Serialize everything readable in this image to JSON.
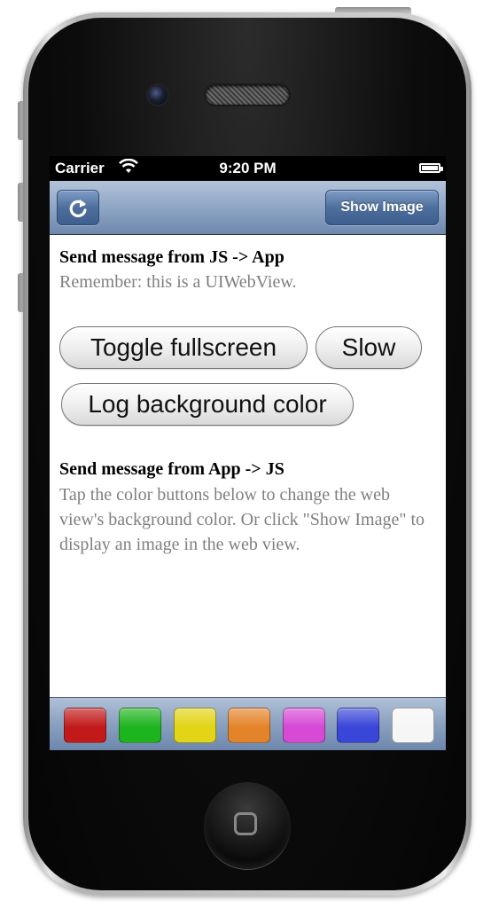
{
  "status_bar": {
    "carrier": "Carrier",
    "time": "9:20 PM"
  },
  "nav_bar": {
    "show_image_label": "Show Image",
    "refresh_icon": "refresh-icon"
  },
  "section_js_to_app": {
    "heading": "Send message from JS -> App",
    "subtitle": "Remember: this is a UIWebView.",
    "buttons": [
      "Toggle fullscreen",
      "Slow",
      "Log background color"
    ]
  },
  "section_app_to_js": {
    "heading": "Send message from App -> JS",
    "text": "Tap the color buttons below to change the web view's background color. Or click \"Show Image\" to display an image in the web view."
  },
  "toolbar": {
    "colors": [
      "#c21a1a",
      "#1eb41e",
      "#e2d416",
      "#e3842a",
      "#d64ad6",
      "#3a46d8",
      "#f6f6f6"
    ]
  }
}
